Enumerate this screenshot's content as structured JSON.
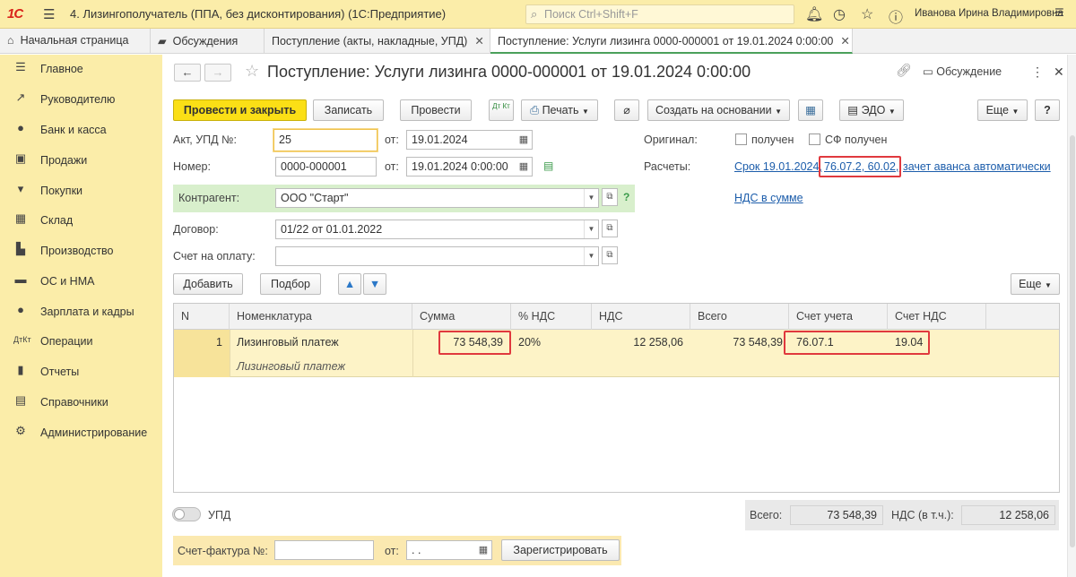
{
  "titlebar": {
    "logo": "1С",
    "title": "4. Лизингополучатель (ППА, без дисконтирования)  (1С:Предприятие)",
    "search_placeholder": "Поиск Ctrl+Shift+F",
    "user": "Иванова Ирина Владимировна"
  },
  "tabs": {
    "home": "Начальная страница",
    "discussions": "Обсуждения",
    "receipts_list": "Поступление (акты, накладные, УПД)",
    "current": "Поступление: Услуги лизинга 0000-000001 от 19.01.2024 0:00:00"
  },
  "sidebar": {
    "items": [
      {
        "label": "Главное",
        "icon": "menu-icon"
      },
      {
        "label": "Руководителю",
        "icon": "trend-icon"
      },
      {
        "label": "Банк и касса",
        "icon": "coin-icon"
      },
      {
        "label": "Продажи",
        "icon": "bag-icon"
      },
      {
        "label": "Покупки",
        "icon": "cart-icon"
      },
      {
        "label": "Склад",
        "icon": "grid-icon"
      },
      {
        "label": "Производство",
        "icon": "factory-icon"
      },
      {
        "label": "ОС и НМА",
        "icon": "truck-icon"
      },
      {
        "label": "Зарплата и кадры",
        "icon": "person-icon"
      },
      {
        "label": "Операции",
        "icon": "dt-kt-icon"
      },
      {
        "label": "Отчеты",
        "icon": "bar-chart-icon"
      },
      {
        "label": "Справочники",
        "icon": "book-icon"
      },
      {
        "label": "Администрирование",
        "icon": "gear-icon"
      }
    ]
  },
  "header": {
    "title": "Поступление: Услуги лизинга 0000-000001 от 19.01.2024 0:00:00",
    "discussion": "Обсуждение"
  },
  "toolbar": {
    "post_close": "Провести и закрыть",
    "save": "Записать",
    "post": "Провести",
    "dtkt": "Дт Кт",
    "print": "Печать",
    "create_based": "Создать на основании",
    "edo": "ЭДО",
    "more": "Еще",
    "help": "?"
  },
  "form": {
    "act_label": "Акт, УПД №:",
    "act_value": "25",
    "from_label": "от:",
    "act_date": "19.01.2024",
    "number_label": "Номер:",
    "number_value": "0000-000001",
    "number_date": "19.01.2024  0:00:00",
    "original_label": "Оригинал:",
    "received": "получен",
    "sf_received": "СФ получен",
    "settlements_label": "Расчеты:",
    "settlements_term": "Срок 19.01.2024,",
    "settlements_accounts": "76.07.2, 60.02,",
    "settlements_advance": "зачет аванса автоматически",
    "vat_link": "НДС в сумме",
    "counterparty_label": "Контрагент:",
    "counterparty_value": "ООО \"Старт\"",
    "help_q": "?",
    "contract_label": "Договор:",
    "contract_value": "01/22 от 01.01.2022",
    "invoice_label": "Счет на оплату:",
    "invoice_value": ""
  },
  "table_toolbar": {
    "add": "Добавить",
    "pick": "Подбор",
    "more": "Еще"
  },
  "table": {
    "columns": [
      "N",
      "Номенклатура",
      "Сумма",
      "% НДС",
      "НДС",
      "Всего",
      "Счет учета",
      "Счет НДС"
    ],
    "rows": [
      {
        "n": "1",
        "item": "Лизинговый платеж",
        "item_sub": "Лизинговый платеж",
        "sum": "73 548,39",
        "vat_rate": "20%",
        "vat": "12 258,06",
        "total": "73 548,39",
        "account": "76.07.1",
        "vat_account": "19.04"
      }
    ]
  },
  "footer": {
    "upd": "УПД",
    "total_label": "Всего:",
    "total_value": "73 548,39",
    "vat_label": "НДС (в т.ч.):",
    "vat_value": "12 258,06",
    "sf_label": "Счет-фактура №:",
    "sf_value": "",
    "sf_from_label": "от:",
    "sf_date": " .  .",
    "register": "Зарегистрировать"
  }
}
